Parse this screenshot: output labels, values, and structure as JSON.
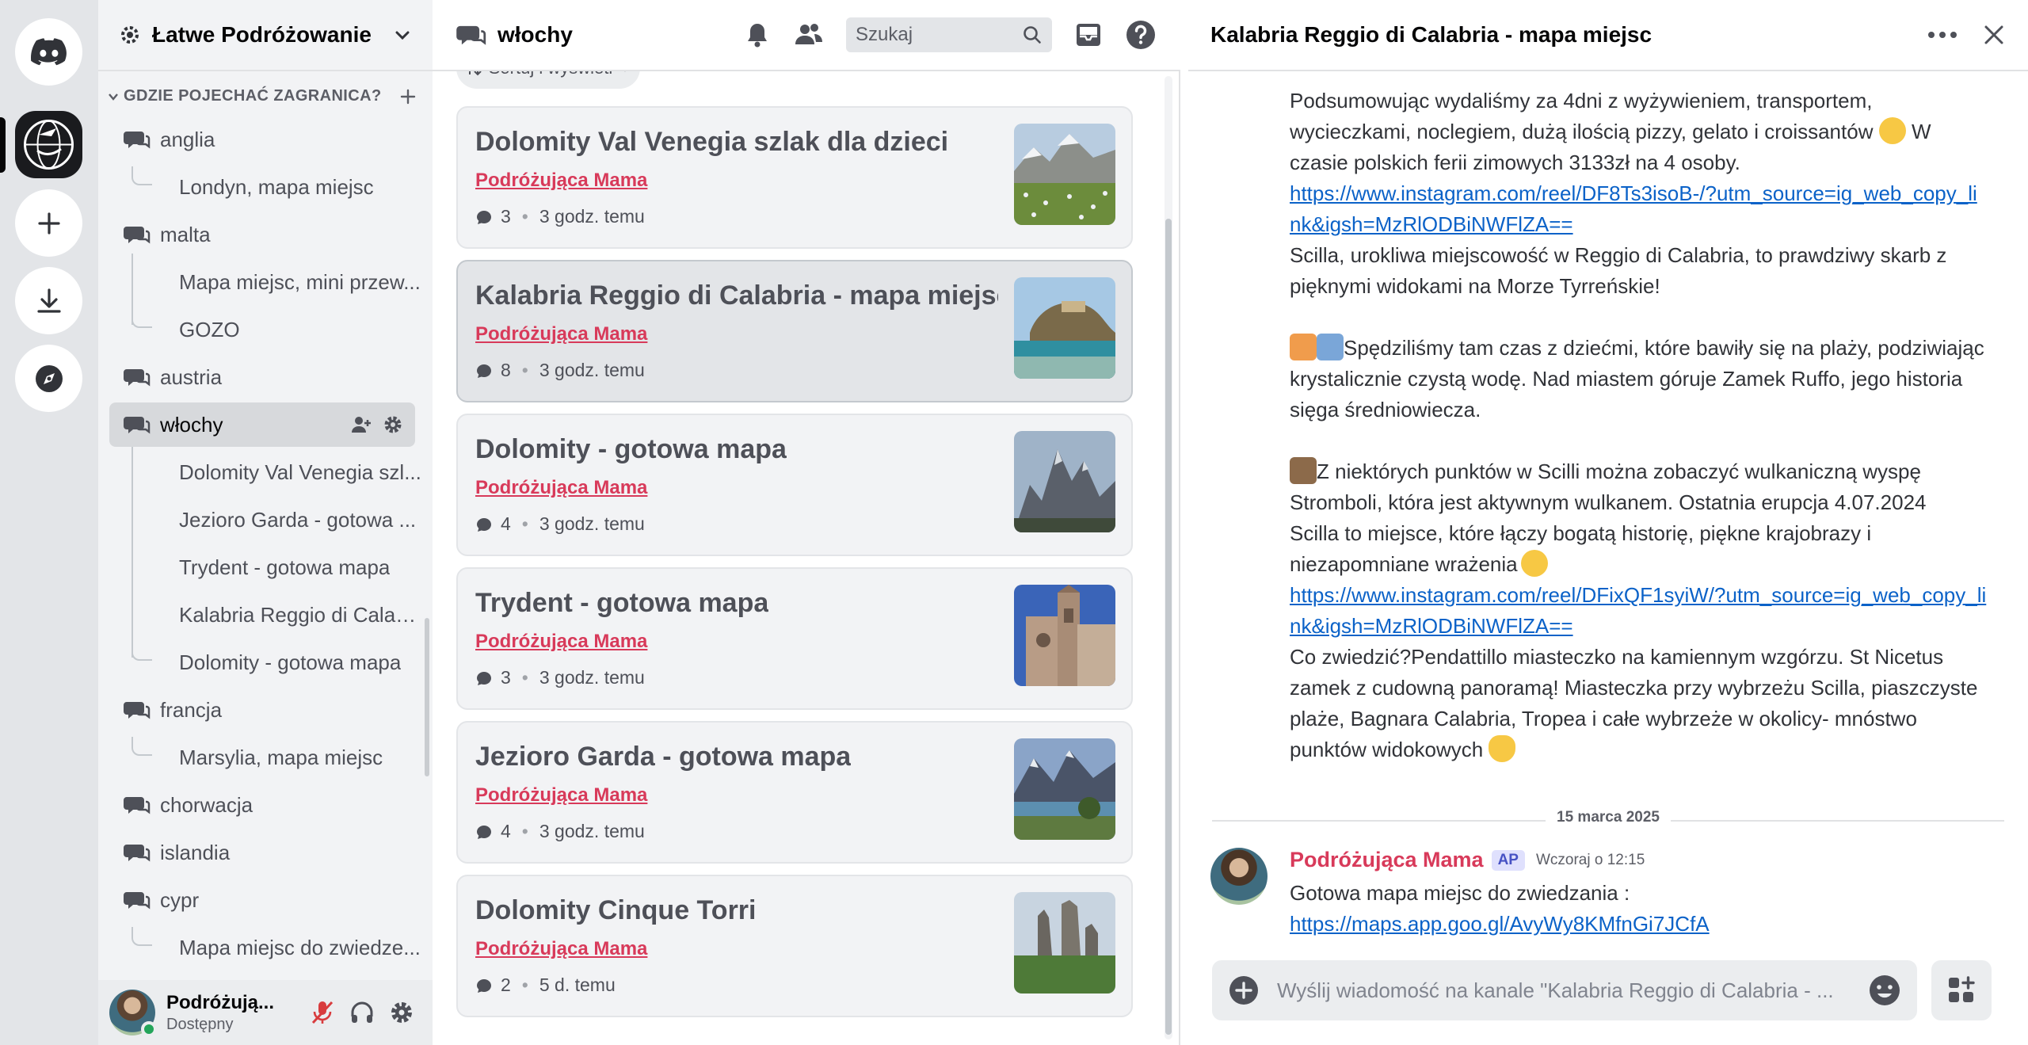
{
  "server": {
    "name": "Łatwe Podróżowanie",
    "category": "GDZIE POJECHAĆ ZAGRANICA?"
  },
  "channels": [
    {
      "label": "anglia"
    },
    {
      "label": "Londyn, mapa miejsc"
    },
    {
      "label": "malta"
    },
    {
      "label": "Mapa miejsc, mini przew..."
    },
    {
      "label": "GOZO"
    },
    {
      "label": "austria"
    },
    {
      "label": "włochy"
    },
    {
      "label": "Dolomity Val Venegia szl..."
    },
    {
      "label": "Jezioro Garda - gotowa ..."
    },
    {
      "label": "Trydent - gotowa mapa"
    },
    {
      "label": "Kalabria Reggio di Calab..."
    },
    {
      "label": "Dolomity - gotowa mapa"
    },
    {
      "label": "francja"
    },
    {
      "label": "Marsylia, mapa miejsc"
    },
    {
      "label": "chorwacja"
    },
    {
      "label": "islandia"
    },
    {
      "label": "cypr"
    },
    {
      "label": "Mapa miejsc do zwiedze..."
    }
  ],
  "user": {
    "name": "Podróżują...",
    "status": "Dostępny"
  },
  "forum": {
    "title": "włochy",
    "search_placeholder": "Szukaj",
    "sort_label": "Sortuj i wyświetl",
    "posts": [
      {
        "title": "Dolomity Val Venegia szlak dla dzieci",
        "author": "Podróżująca Mama",
        "count": "3",
        "time": "3 godz. temu"
      },
      {
        "title": "Kalabria Reggio di Calabria - mapa miejsc",
        "author": "Podróżująca Mama",
        "count": "8",
        "time": "3 godz. temu"
      },
      {
        "title": "Dolomity - gotowa mapa",
        "author": "Podróżująca Mama",
        "count": "4",
        "time": "3 godz. temu"
      },
      {
        "title": "Trydent - gotowa mapa",
        "author": "Podróżująca Mama",
        "count": "3",
        "time": "3 godz. temu"
      },
      {
        "title": "Jezioro Garda - gotowa mapa",
        "author": "Podróżująca Mama",
        "count": "4",
        "time": "3 godz. temu"
      },
      {
        "title": "Dolomity Cinque Torri",
        "author": "Podróżująca Mama",
        "count": "2",
        "time": "5 d. temu"
      }
    ]
  },
  "thread": {
    "title": "Kalabria Reggio di Calabria - mapa miejsc",
    "p1": "Podsumowując wydaliśmy za 4dni z wyżywieniem, transportem, wycieczkami, noclegiem, dużą ilością pizzy, gelato i croissantów",
    "p1_end": "W czasie polskich ferii zimowych 3133zł na 4 osoby.",
    "link1": "https://www.instagram.com/reel/DF8Ts3isoB-/?utm_source=ig_web_copy_link&igsh=MzRlODBiNWFlZA==",
    "p2": "Scilla, urokliwa miejscowość w Reggio di Calabria, to prawdziwy skarb z pięknymi widokami na Morze Tyrreńskie!",
    "p3": "Spędziliśmy tam czas z dziećmi, które bawiły się na plaży, podziwiając krystalicznie czystą wodę. Nad miastem góruje Zamek Ruffo, jego historia sięga średniowiecza.",
    "p4": "Z niektórych punktów w Scilli można zobaczyć wulkaniczną wyspę Stromboli, która jest aktywnym wulkanem. Ostatnia erupcja 4.07.2024",
    "p5": "Scilla to miejsce, które łączy bogatą historię, piękne krajobrazy i niezapomniane wrażenia",
    "link2": "https://www.instagram.com/reel/DFixQF1syiW/?utm_source=ig_web_copy_link&igsh=MzRlODBiNWFlZA==",
    "p6": "Co zwiedzić?Pendattillo miasteczko na kamiennym wzgórzu. St Nicetus zamek z cudowną panoramą! Miasteczka przy wybrzeżu Scilla, piaszczyste plaże, Bagnara Calabria, Tropea i całe wybrzeże w okolicy- mnóstwo punktów widokowych",
    "date_divider": "15 marca 2025",
    "author": "Podróżująca Mama",
    "author_tag": "AP",
    "timestamp": "Wczoraj o 12:15",
    "msg2_text": "Gotowa mapa miejsc do zwiedzania :",
    "msg2_link": "https://maps.app.goo.gl/AvyWy8KMfnGi7JCfA",
    "composer_placeholder": "Wyślij wiadomość na kanale \"Kalabria Reggio di Calabria - ..."
  },
  "colors": {
    "accent": "#d83a5a",
    "link": "#0b62c8",
    "online": "#23a55a"
  }
}
